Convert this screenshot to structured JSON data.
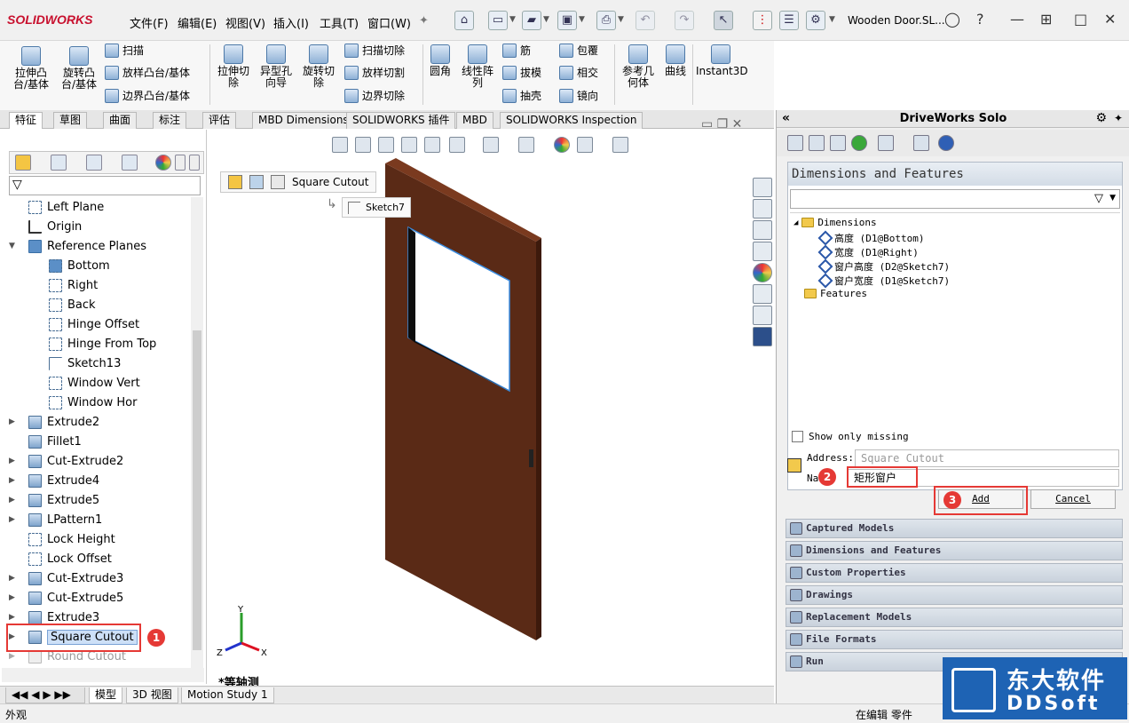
{
  "app": {
    "logo": "SOLIDWORKS",
    "doc_title": "Wooden Door.SL..."
  },
  "menu": [
    "文件(F)",
    "编辑(E)",
    "视图(V)",
    "插入(I)",
    "工具(T)",
    "窗口(W)"
  ],
  "commands": {
    "extrude_boss": "拉伸凸\n台/基体",
    "revolve_boss": "旋转凸\n台/基体",
    "sweep": "扫描",
    "loft_boss": "放样凸台/基体",
    "boundary_boss": "边界凸台/基体",
    "extrude_cut": "拉伸切\n除",
    "hole_wizard": "异型孔\n向导",
    "revolve_cut": "旋转切\n除",
    "sweep_cut": "扫描切除",
    "loft_cut": "放样切割",
    "boundary_cut": "边界切除",
    "fillet": "圆角",
    "linear_pattern": "线性阵\n列",
    "rib": "筋",
    "draft": "拔模",
    "shell": "抽壳",
    "wrap": "包覆",
    "intersect": "相交",
    "mirror": "镜向",
    "ref_geometry": "参考几\n何体",
    "curves": "曲线",
    "instant3d": "Instant3D"
  },
  "tabs": [
    "特征",
    "草图",
    "曲面",
    "标注",
    "评估",
    "MBD Dimensions",
    "SOLIDWORKS 插件",
    "MBD",
    "SOLIDWORKS Inspection"
  ],
  "tree": {
    "items": [
      {
        "label": "Left Plane",
        "kind": "plane"
      },
      {
        "label": "Origin",
        "kind": "origin"
      },
      {
        "label": "Reference Planes",
        "kind": "folder"
      },
      {
        "label": "Bottom",
        "kind": "plane-sel"
      },
      {
        "label": "Right",
        "kind": "plane"
      },
      {
        "label": "Back",
        "kind": "plane"
      },
      {
        "label": "Hinge Offset",
        "kind": "plane"
      },
      {
        "label": "Hinge From Top",
        "kind": "plane"
      },
      {
        "label": "Sketch13",
        "kind": "sketch"
      },
      {
        "label": "Window Vert",
        "kind": "plane"
      },
      {
        "label": "Window Hor",
        "kind": "plane"
      },
      {
        "label": "Extrude2",
        "kind": "solid"
      },
      {
        "label": "Fillet1",
        "kind": "solid"
      },
      {
        "label": "Cut-Extrude2",
        "kind": "solid"
      },
      {
        "label": "Extrude4",
        "kind": "solid"
      },
      {
        "label": "Extrude5",
        "kind": "solid"
      },
      {
        "label": "LPattern1",
        "kind": "solid"
      },
      {
        "label": "Lock Height",
        "kind": "plane"
      },
      {
        "label": "Lock Offset",
        "kind": "plane"
      },
      {
        "label": "Cut-Extrude3",
        "kind": "solid"
      },
      {
        "label": "Cut-Extrude5",
        "kind": "solid"
      },
      {
        "label": "Extrude3",
        "kind": "solid"
      },
      {
        "label": "Square Cutout",
        "kind": "solid"
      },
      {
        "label": "Round Cutout",
        "kind": "dim"
      }
    ]
  },
  "viewport": {
    "breadcrumb": "Square Cutout",
    "sketch_chip": "Sketch7",
    "view_label": "*等轴测",
    "triad": {
      "x": "X",
      "y": "Y",
      "z": "Z"
    }
  },
  "bottom_tabs": [
    "模型",
    "3D 视图",
    "Motion Study 1"
  ],
  "status": {
    "left": "外观",
    "right": "在编辑 零件"
  },
  "driveworks": {
    "title": "DriveWorks Solo",
    "section_title": "Dimensions and Features",
    "tree": {
      "dimensions_label": "Dimensions",
      "dims": [
        "高度 (D1@Bottom)",
        "宽度 (D1@Right)",
        "窗户高度 (D2@Sketch7)",
        "窗户宽度 (D1@Sketch7)"
      ],
      "features_label": "Features"
    },
    "show_only_missing": "Show only missing",
    "address_label": "Address:",
    "address_value": "Square Cutout",
    "name_label": "Na",
    "name_value": "矩形窗户",
    "add_button": "Add",
    "cancel_button": "Cancel",
    "nav": [
      "Captured Models",
      "Dimensions and Features",
      "Custom Properties",
      "Drawings",
      "Replacement Models",
      "File Formats",
      "Run"
    ]
  },
  "annotations": {
    "badge1": "1",
    "badge2": "2",
    "badge3": "3"
  },
  "watermark": {
    "cn": "东大软件",
    "en": "DDSoft"
  }
}
